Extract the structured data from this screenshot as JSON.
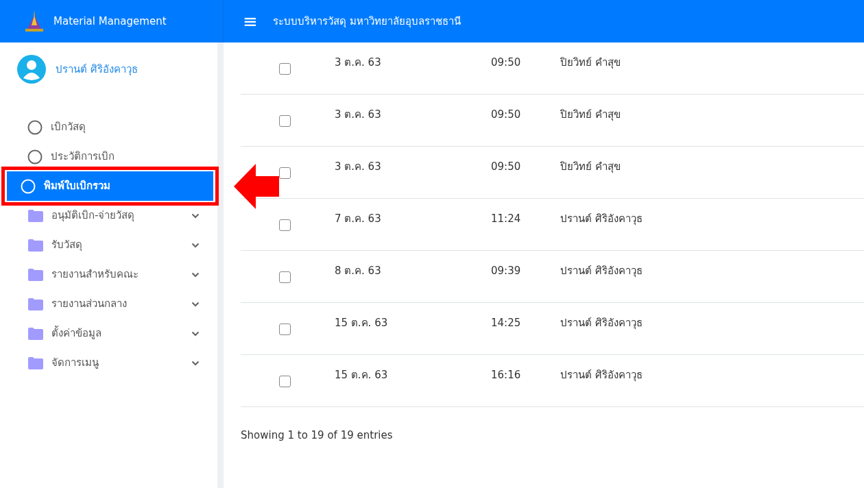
{
  "brand": {
    "title": "Material Management"
  },
  "header": {
    "menu_icon": "≡",
    "title": "ระบบบริหารวัสดุ มหาวิทยาลัยอุบลราชธานี"
  },
  "user": {
    "name": "ปรานต์ ศิริอังคาวุธ"
  },
  "sidebar": {
    "items": [
      {
        "kind": "link",
        "label": "เบิกวัสดุ",
        "selected": false
      },
      {
        "kind": "link",
        "label": "ประวัติการเบิก",
        "selected": false
      },
      {
        "kind": "link",
        "label": "พิมพ์ใบเบิกรวม",
        "selected": true
      },
      {
        "kind": "folder",
        "label": "อนุมัติเบิก-จ่ายวัสดุ",
        "selected": false
      },
      {
        "kind": "folder",
        "label": "รับวัสดุ",
        "selected": false
      },
      {
        "kind": "folder",
        "label": "รายงานสำหรับคณะ",
        "selected": false
      },
      {
        "kind": "folder",
        "label": "รายงานส่วนกลาง",
        "selected": false
      },
      {
        "kind": "folder",
        "label": "ตั้งค่าข้อมูล",
        "selected": false
      },
      {
        "kind": "folder",
        "label": "จัดการเมนู",
        "selected": false
      }
    ]
  },
  "table": {
    "rows": [
      {
        "checked": false,
        "date": "3 ต.ค. 63",
        "time": "09:50",
        "name": "ปิยวิทย์ คำสุข"
      },
      {
        "checked": false,
        "date": "3 ต.ค. 63",
        "time": "09:50",
        "name": "ปิยวิทย์ คำสุข"
      },
      {
        "checked": false,
        "date": "3 ต.ค. 63",
        "time": "09:50",
        "name": "ปิยวิทย์ คำสุข"
      },
      {
        "checked": false,
        "date": "7 ต.ค. 63",
        "time": "11:24",
        "name": "ปรานต์ ศิริอังคาวุธ"
      },
      {
        "checked": false,
        "date": "8 ต.ค. 63",
        "time": "09:39",
        "name": "ปรานต์ ศิริอังคาวุธ"
      },
      {
        "checked": false,
        "date": "15 ต.ค. 63",
        "time": "14:25",
        "name": "ปรานต์ ศิริอังคาวุธ"
      },
      {
        "checked": false,
        "date": "15 ต.ค. 63",
        "time": "16:16",
        "name": "ปรานต์ ศิริอังคาวุธ"
      }
    ],
    "info": "Showing 1 to 19 of 19 entries"
  },
  "annotation": {
    "kind": "highlight-arrow"
  }
}
